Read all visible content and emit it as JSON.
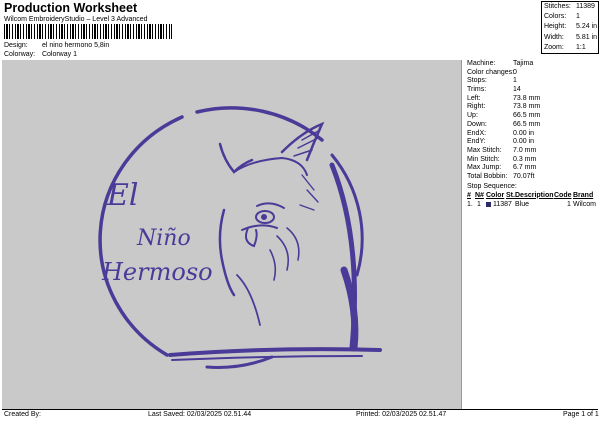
{
  "header": {
    "title": "Production Worksheet",
    "subtitle": "Wilcom EmbroideryStudio – Level 3 Advanced"
  },
  "meta": {
    "design_label": "Design:",
    "design_value": "el nino hermono 5,8in",
    "colorway_label": "Colorway:",
    "colorway_value": "Colorway 1"
  },
  "stats": [
    {
      "k": "Stitches:",
      "v": "11389"
    },
    {
      "k": "Colors:",
      "v": "1"
    },
    {
      "k": "Height:",
      "v": "5.24 in"
    },
    {
      "k": "Width:",
      "v": "5.81 in"
    },
    {
      "k": "Zoom:",
      "v": "1:1"
    }
  ],
  "artwork": {
    "lines": [
      "El",
      "Niño",
      "Hermoso"
    ],
    "thread_color": "#4b3a98"
  },
  "machine_info": [
    {
      "k": "Machine:",
      "v": "Tajima"
    },
    {
      "k": "Color changes:",
      "v": "0"
    },
    {
      "k": "Stops:",
      "v": "1"
    },
    {
      "k": "Trims:",
      "v": "14"
    },
    {
      "k": "Left:",
      "v": "73.8 mm"
    },
    {
      "k": "Right:",
      "v": "73.8 mm"
    },
    {
      "k": "Up:",
      "v": "66.5 mm"
    },
    {
      "k": "Down:",
      "v": "66.5 mm"
    },
    {
      "k": "EndX:",
      "v": "0.00 in"
    },
    {
      "k": "EndY:",
      "v": "0.00 in"
    },
    {
      "k": "Max Stitch:",
      "v": "7.0 mm"
    },
    {
      "k": "Min Stitch:",
      "v": "0.3 mm"
    },
    {
      "k": "Max Jump:",
      "v": "6.7 mm"
    },
    {
      "k": "Total Bobbin:",
      "v": "70.07ft"
    }
  ],
  "stop_sequence": {
    "title": "Stop Sequence:",
    "headers": [
      "#",
      "N#",
      "Color",
      "St.",
      "Description",
      "Code",
      "Brand"
    ],
    "rows": [
      {
        "num": "1.",
        "n": "1",
        "color": "11387",
        "desc": "Blue",
        "code": "1",
        "brand": "Wilcom",
        "swatch": "#2b2b6b"
      }
    ]
  },
  "footer": {
    "created_by": "Created By:",
    "last_saved": "Last Saved: 02/03/2025 02.51.44",
    "printed": "Printed: 02/03/2025 02.51.47",
    "page": "Page 1 of 1"
  }
}
